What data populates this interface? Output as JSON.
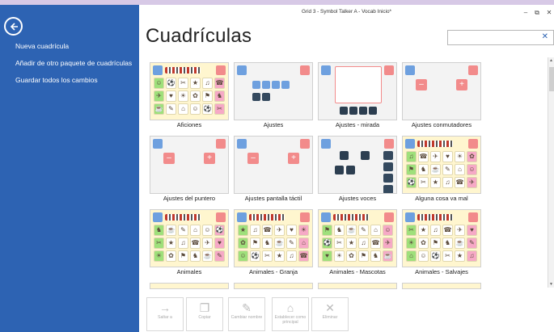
{
  "window": {
    "title": "Grid 3 - Symbol Talker A - Vocab Inicio*",
    "minimize": "–",
    "restore": "⧉",
    "close": "✕"
  },
  "sidebar": {
    "items": [
      {
        "label": "Nueva cuadrícula"
      },
      {
        "label": "Añadir de otro paquete de cuadrículas"
      },
      {
        "label": "Guardar todos los cambios"
      }
    ]
  },
  "page": {
    "heading": "Cuadrículas"
  },
  "search": {
    "value": "",
    "clear_icon": "✕"
  },
  "grids": [
    {
      "label": "Aficiones",
      "kind": "vocab"
    },
    {
      "label": "Ajustes",
      "kind": "ajustes"
    },
    {
      "label": "Ajustes - mirada",
      "kind": "mirada"
    },
    {
      "label": "Ajustes conmutadores",
      "kind": "plusminus"
    },
    {
      "label": "Ajustes del puntero",
      "kind": "plusminus"
    },
    {
      "label": "Ajustes pantalla táctil",
      "kind": "plusminus"
    },
    {
      "label": "Ajustes voces",
      "kind": "voces"
    },
    {
      "label": "Alguna cosa va mal",
      "kind": "vocab"
    },
    {
      "label": "Animales",
      "kind": "vocab"
    },
    {
      "label": "Animales - Granja",
      "kind": "vocab"
    },
    {
      "label": "Animales - Mascotas",
      "kind": "vocab"
    },
    {
      "label": "Animales - Salvajes",
      "kind": "vocab"
    }
  ],
  "toolbar": {
    "buttons": [
      {
        "label": "Saltar a",
        "icon": "arrow-right-icon",
        "glyph": "→"
      },
      {
        "label": "Copiar",
        "icon": "copy-icon",
        "glyph": "❐"
      },
      {
        "label": "Cambiar nombre",
        "icon": "rename-icon",
        "glyph": "✎"
      },
      {
        "label": "Establecer como principal",
        "icon": "home-icon",
        "glyph": "⌂"
      },
      {
        "label": "Eliminar",
        "icon": "delete-icon",
        "glyph": "✕"
      }
    ]
  },
  "colors": {
    "sidebar": "#2d63b3",
    "accent_blue": "#6ea0df",
    "accent_pink": "#f28b8b",
    "thumb_bg": "#fff6cf",
    "grid_green": "#9fe07b",
    "grid_pink": "#f6a9c6",
    "grid_yellow": "#fff0a0"
  }
}
